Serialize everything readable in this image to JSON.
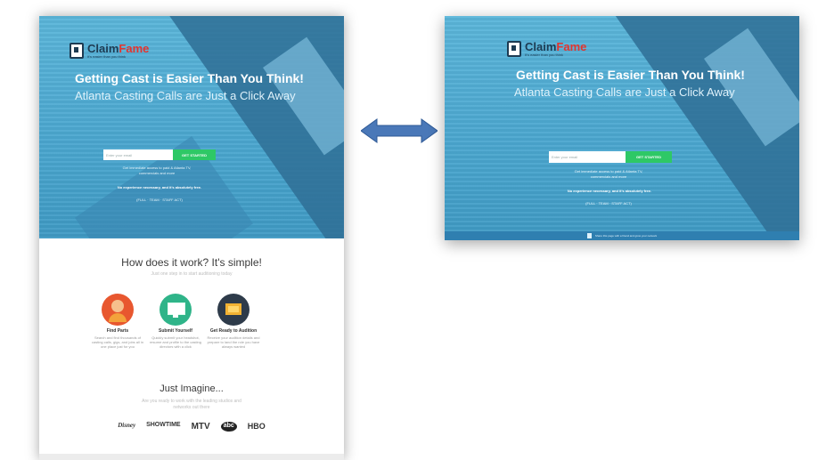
{
  "brand": {
    "name_part1": "Claim",
    "name_part2": "Fame",
    "tagline": "It's easier than you think",
    "colors": {
      "primary_text": "#1d3b52",
      "accent": "#e2342f",
      "cta": "#2ec866",
      "hero": "#4aa8cf"
    }
  },
  "hero": {
    "headline": "Getting Cast is Easier Than You Think!",
    "subheadline": "Atlanta Casting Calls are Just a Click Away",
    "email_placeholder": "Enter your email",
    "cta_label": "GET STARTED",
    "line1": "Get immediate access to paid & Atlanta TV,",
    "line2": "commercials and more",
    "bold_line": "No experience necessary, and it's absolutely free.",
    "small_line": "(FULL · TEAM · STAFF ACT)"
  },
  "how": {
    "title": "How does it work? It's simple!",
    "subtitle": "Just one step in to start auditioning today",
    "features": [
      {
        "icon": "person-icon",
        "title": "Find Parts",
        "desc": "Search and find thousands of casting calls, gigs, and jobs all in one place just for you"
      },
      {
        "icon": "monitor-icon",
        "title": "Submit Yourself",
        "desc": "Quickly submit your headshot, resume and profile to the casting directors with a click"
      },
      {
        "icon": "folder-icon",
        "title": "Get Ready to Audition",
        "desc": "Receive your audition details and prepare to land the role you have always wanted"
      }
    ]
  },
  "imagine": {
    "title": "Just Imagine...",
    "subtitle1": "Are you ready to work with the leading studios and",
    "subtitle2": "networks out there",
    "brands": [
      "Disney",
      "SHOWTIME",
      "MTV",
      "abc",
      "HBO"
    ]
  },
  "right_bar_text": "Share this page with a friend and grow your network"
}
